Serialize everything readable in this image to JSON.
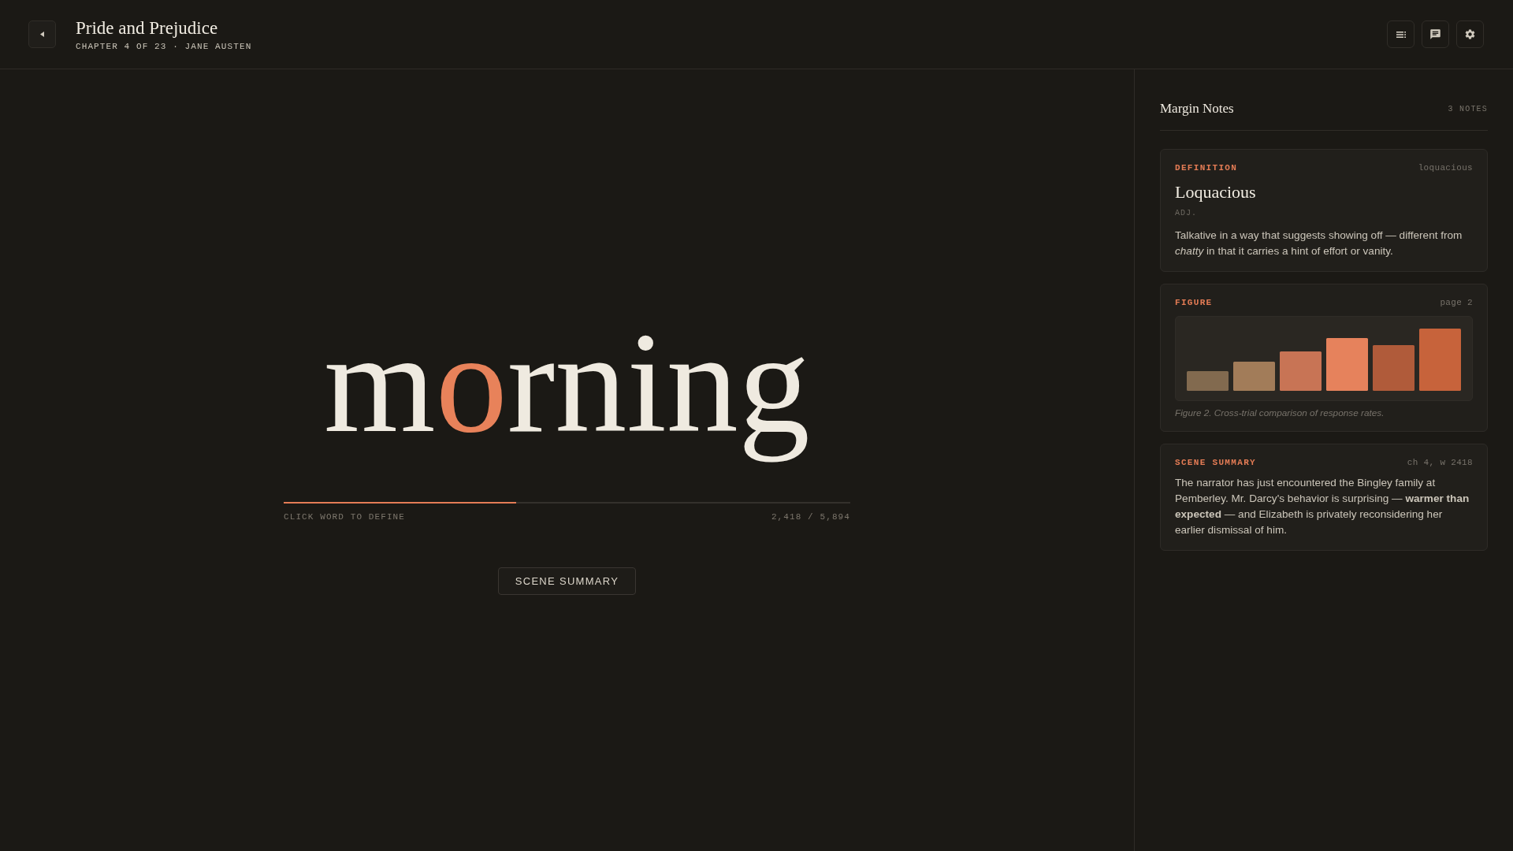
{
  "header": {
    "title": "Pride and Prejudice",
    "subtitle": "CHAPTER 4 OF 23 · JANE AUSTEN"
  },
  "reader": {
    "word": {
      "lead": "m",
      "focus": "o",
      "tail": "rning"
    },
    "progress": {
      "level": 0.41
    },
    "hint": "CLICK WORD TO DEFINE",
    "position": "2,418 / 5,894",
    "button": "SCENE SUMMARY"
  },
  "margin_notes": {
    "title": "Margin Notes",
    "count": "3 NOTES",
    "notes": [
      {
        "kind": "definition",
        "label": "DEFINITION",
        "reference": "loquacious",
        "term": "Loquacious",
        "part_of_speech": "ADJ.",
        "text": "Talkative in a way that suggests showing off — different from *chatty* in that it carries a hint of effort or vanity."
      },
      {
        "kind": "figure",
        "label": "FIGURE",
        "reference": "page 2",
        "caption": "Figure 2. Cross-trial comparison of response rates."
      },
      {
        "kind": "summary",
        "label": "SCENE SUMMARY",
        "reference": "ch 4, w 2418",
        "text": "The narrator has just encountered the Bingley family at Pemberley. Mr. Darcy's behavior is surprising — **warmer than expected** — and Elizabeth is privately reconsidering her earlier dismissal of him."
      }
    ]
  }
}
